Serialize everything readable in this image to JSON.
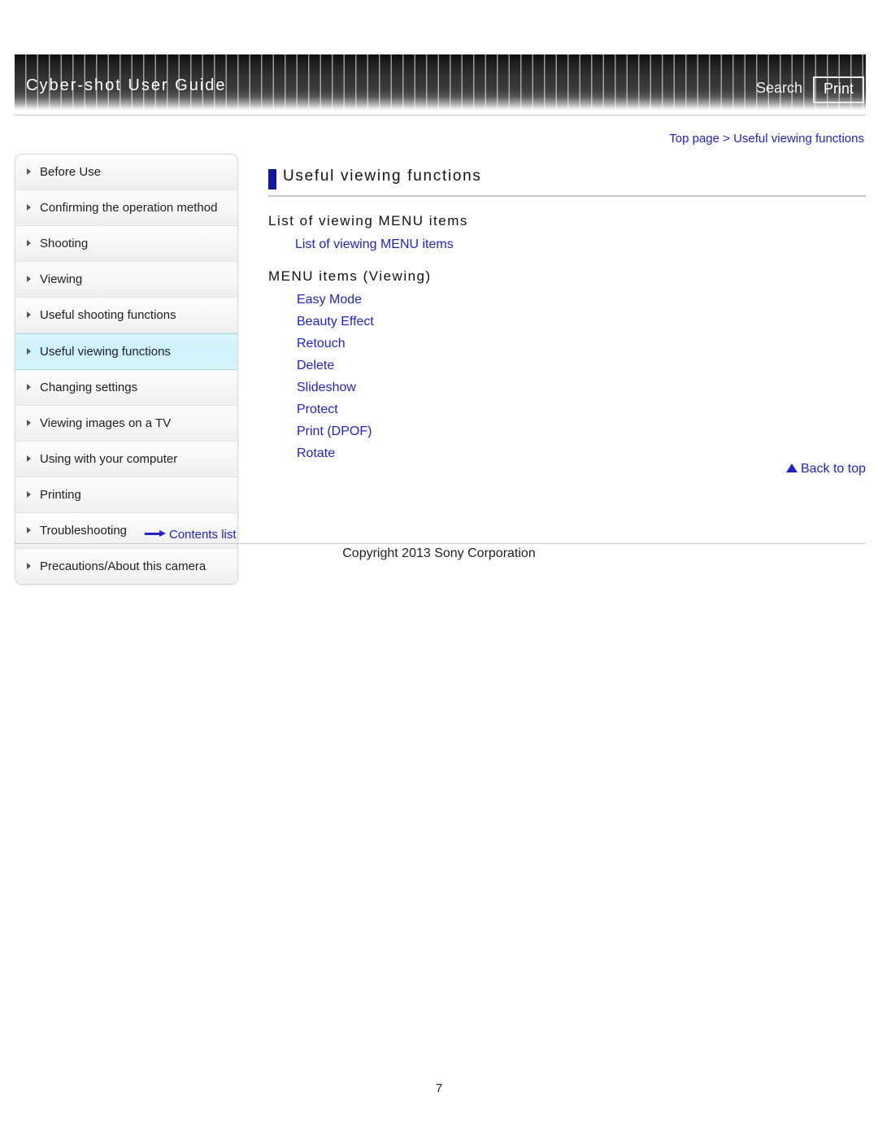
{
  "header": {
    "site_title": "Cyber-shot User Guide",
    "search_label": "Search",
    "print_label": "Print"
  },
  "breadcrumb": {
    "text": "Top page > Useful viewing functions"
  },
  "sidebar": {
    "items": [
      {
        "label": "Before Use",
        "selected": false
      },
      {
        "label": "Confirming the operation method",
        "selected": false
      },
      {
        "label": "Shooting",
        "selected": false
      },
      {
        "label": "Viewing",
        "selected": false
      },
      {
        "label": "Useful shooting functions",
        "selected": false
      },
      {
        "label": "Useful viewing functions",
        "selected": true
      },
      {
        "label": "Changing settings",
        "selected": false
      },
      {
        "label": "Viewing images on a TV",
        "selected": false
      },
      {
        "label": "Using with your computer",
        "selected": false
      },
      {
        "label": "Printing",
        "selected": false
      },
      {
        "label": "Troubleshooting",
        "selected": false
      },
      {
        "label": "Precautions/About this camera",
        "selected": false
      }
    ],
    "contents_list_label": "Contents list"
  },
  "main": {
    "page_title": "Useful viewing functions",
    "sections": [
      {
        "heading": "List of viewing MENU items",
        "links": [
          "List of viewing MENU items"
        ]
      },
      {
        "heading": "MENU items (Viewing)",
        "links": [
          "Easy Mode",
          "Beauty Effect",
          "Retouch",
          "Delete",
          "Slideshow",
          "Protect",
          "Print (DPOF)",
          "Rotate"
        ]
      }
    ],
    "back_to_top_label": "Back to top"
  },
  "footer": {
    "copyright": "Copyright 2013 Sony Corporation",
    "page_number": "7"
  },
  "colors": {
    "link": "#2222cc",
    "title_accent": "#1414a0",
    "selected_nav": "#cdf2fc"
  }
}
